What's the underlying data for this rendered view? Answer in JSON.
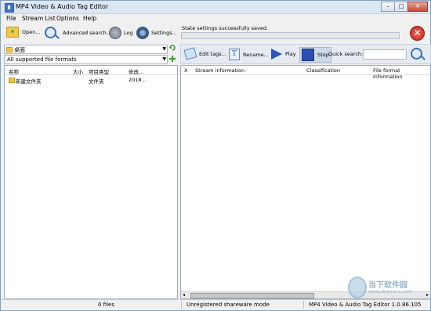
{
  "window": {
    "title": "MP4 Video & Audio Tag Editor",
    "buttons": {
      "minimize": "–",
      "maximize": "□",
      "close": "✕"
    }
  },
  "menu": [
    "File",
    "Stream List",
    "Options",
    "Help"
  ],
  "left": {
    "toolbar": {
      "open": "Open...",
      "advanced_search": "Advanced search...",
      "log": "Log",
      "settings": "Settings..."
    },
    "path": "桌面",
    "filter": "All supported file formats",
    "columns": [
      "名称",
      "大小",
      "项目类型",
      "修改..."
    ],
    "rows": [
      {
        "name": "新建文件夹",
        "size": "",
        "type": "文件夹",
        "modified": "2018..."
      }
    ]
  },
  "right": {
    "status": "State settings successfully saved.",
    "toolbar": {
      "edit_tags": "Edit tags...",
      "rename": "Rename...",
      "play": "Play",
      "stop": "Stop",
      "quick_search_label": "Quick search:",
      "quick_search_value": ""
    },
    "columns": [
      "X",
      "Stream information",
      "Classification",
      "File format information"
    ]
  },
  "statusbar": {
    "files": "0 files",
    "mode": "Unregistered shareware mode",
    "version": "MP4 Video & Audio Tag Editor 1.0.86.105"
  },
  "watermark": {
    "text": "当下软件园",
    "url": "www.downxia.com"
  }
}
